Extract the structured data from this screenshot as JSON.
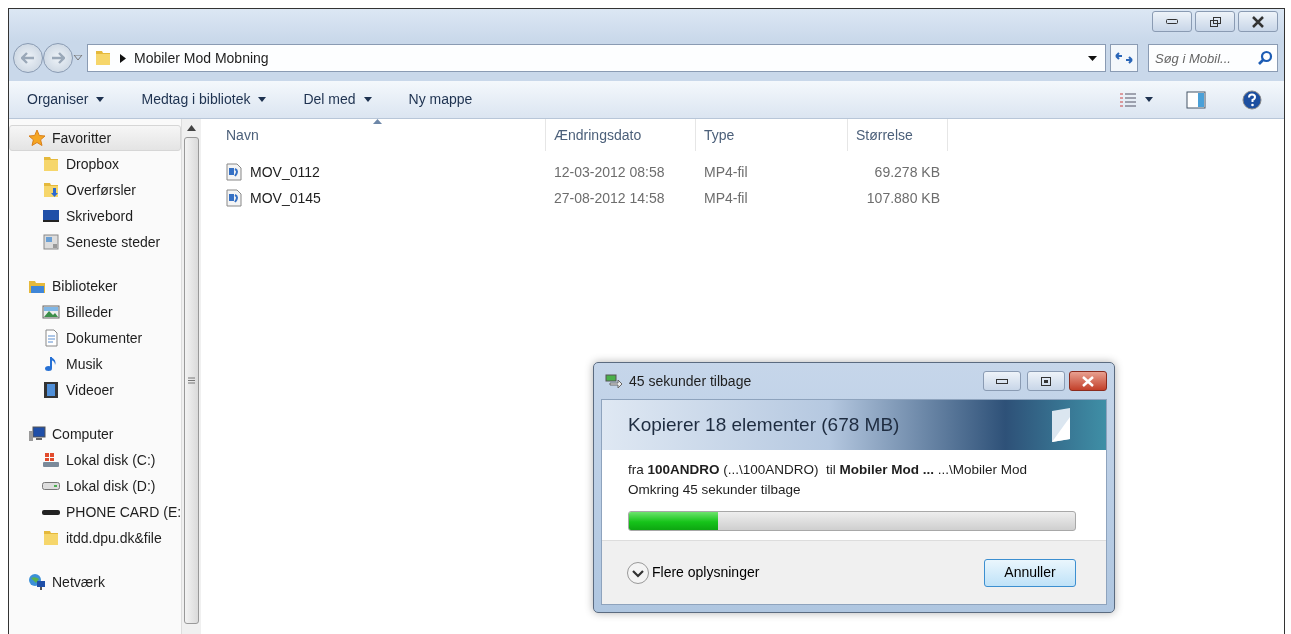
{
  "address_bar": {
    "path": "Mobiler Mod Mobning"
  },
  "search": {
    "placeholder": "Søg i Mobil..."
  },
  "toolbar": {
    "items": [
      {
        "label": "Organiser",
        "dropdown": true
      },
      {
        "label": "Medtag i bibliotek",
        "dropdown": true
      },
      {
        "label": "Del med",
        "dropdown": true
      },
      {
        "label": "Ny mappe",
        "dropdown": false
      }
    ]
  },
  "sidebar": {
    "groups": [
      {
        "label": "Favoritter",
        "kind": "star",
        "selected": true,
        "children": [
          {
            "label": "Dropbox",
            "kind": "folder",
            "selected": false
          },
          {
            "label": "Overførsler",
            "kind": "download",
            "selected": false
          },
          {
            "label": "Skrivebord",
            "kind": "desktop",
            "selected": false
          },
          {
            "label": "Seneste steder",
            "kind": "recent",
            "selected": false
          }
        ]
      },
      {
        "label": "Biblioteker",
        "kind": "library",
        "selected": false,
        "children": [
          {
            "label": "Billeder",
            "kind": "pictures",
            "selected": false
          },
          {
            "label": "Dokumenter",
            "kind": "document",
            "selected": false
          },
          {
            "label": "Musik",
            "kind": "music",
            "selected": false
          },
          {
            "label": "Videoer",
            "kind": "video",
            "selected": false
          }
        ]
      },
      {
        "label": "Computer",
        "kind": "computer",
        "selected": false,
        "children": [
          {
            "label": "Lokal disk (C:)",
            "kind": "system-drive",
            "selected": false
          },
          {
            "label": "Lokal disk (D:)",
            "kind": "drive",
            "selected": false
          },
          {
            "label": "PHONE CARD (E:",
            "kind": "card",
            "selected": false
          },
          {
            "label": "itdd.dpu.dk&file",
            "kind": "folder",
            "selected": false
          }
        ]
      },
      {
        "label": "Netværk",
        "kind": "network",
        "selected": false
      }
    ]
  },
  "table": {
    "columns": [
      {
        "label": "Navn",
        "sorted": true
      },
      {
        "label": "Ændringsdato",
        "sorted": false
      },
      {
        "label": "Type",
        "sorted": false
      },
      {
        "label": "Størrelse",
        "sorted": false
      }
    ],
    "rows": [
      {
        "name": "MOV_0112",
        "date": "12-03-2012 08:58",
        "type": "MP4-fil",
        "size": "69.278 KB"
      },
      {
        "name": "MOV_0145",
        "date": "27-08-2012 14:58",
        "type": "MP4-fil",
        "size": "107.880 KB"
      }
    ]
  },
  "dialog": {
    "title": "45 sekunder tilbage",
    "heading": "Kopierer 18 elementer (678 MB)",
    "from_line": "fra **100ANDRO** (...\\100ANDRO)  til **Mobiler Mod ...** ...\\Mobiler Mod",
    "remaining": "Omkring 45 sekunder tilbage",
    "progress": {
      "level": 0.2
    },
    "details": "Flere oplysninger",
    "cancel": "Annuller"
  }
}
